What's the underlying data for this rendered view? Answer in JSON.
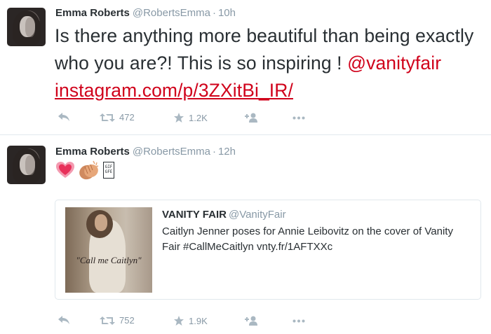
{
  "tweets": [
    {
      "author_name": "Emma Roberts",
      "author_handle": "@RobertsEmma",
      "separator": "·",
      "time": "10h",
      "text_plain": "Is there anything more beautiful than being exactly who you are?! This is so inspiring !",
      "mention": "@vanityfair",
      "link": "instagram.com/p/3ZXitBi_IR/",
      "retweets": "472",
      "likes": "1.2K"
    },
    {
      "author_name": "Emma Roberts",
      "author_handle": "@RobertsEmma",
      "separator": "·",
      "time": "12h",
      "emoji_gif_text": "GIF\nGFE",
      "quoted": {
        "author_name": "VANITY FAIR",
        "author_handle": "@VanityFair",
        "text": "Caitlyn Jenner poses for Annie Leibovitz on the cover of Vanity Fair #CallMeCaitlyn vnty.fr/1AFTXXc",
        "image_caption": "\"Call me Caitlyn\""
      },
      "retweets": "752",
      "likes": "1.9K"
    }
  ],
  "icons": {
    "reply": "reply-icon",
    "retweet": "retweet-icon",
    "like": "star-icon",
    "follow": "add-user-icon",
    "more": "more-dots-icon",
    "heart": "heart-emoji-icon",
    "clap": "clapping-hands-emoji-icon"
  },
  "colors": {
    "link": "#d0021b",
    "muted": "#8899a6",
    "icon": "#aab8c2",
    "text": "#292f33"
  }
}
